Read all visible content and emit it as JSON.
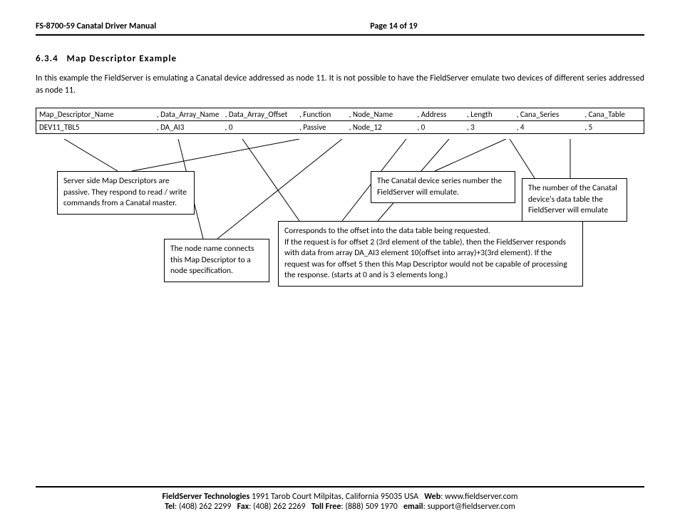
{
  "header": {
    "title": "FS-8700-59 Canatal Driver Manual",
    "page": "Page 14 of 19"
  },
  "section": {
    "number": "6.3.4",
    "title": "Map Descriptor Example",
    "intro": "In this example the FieldServer is emulating a Canatal device addressed as node 11. It is not possible to have the FieldServer emulate two devices of different series addressed as node 11."
  },
  "table": {
    "headers": [
      "Map_Descriptor_Name",
      ", Data_Array_Name",
      ", Data_Array_Offset",
      ", Function",
      ", Node_Name",
      ", Address",
      ", Length",
      ", Cana_Series",
      ", Cana_Table"
    ],
    "row": [
      "DEV11_TBL5",
      ", DA_AI3",
      ", 0",
      ", Passive",
      ", Node_12",
      ", 0",
      ", 3",
      ", 4",
      ", 5"
    ]
  },
  "callouts": {
    "server_side": "Server side Map Descriptors are passive. They respond to read / write commands from a Canatal master.",
    "node_name": "The node name connects this Map Descriptor to a node specification.",
    "series": "The Canatal device series number the FieldServer will emulate.",
    "table_num": "The number of the Canatal device's data table the FieldServer will emulate",
    "offset": "Corresponds to the offset into the data table being requested.\nIf the request is for offset 2 (3rd element of the table), then the FieldServer responds with data from array DA_AI3 element 10(offset into array)+3(3rd element). If the request was for offset 5 then this Map Descriptor would not be capable of processing the response. (starts at 0 and is 3 elements long.)"
  },
  "footer": {
    "company": "FieldServer Technologies",
    "address": "1991 Tarob Court Milpitas, California 95035 USA",
    "web_label": "Web",
    "web": "www.fieldserver.com",
    "tel_label": "Tel",
    "tel": "(408) 262 2299",
    "fax_label": "Fax",
    "fax": "(408) 262 2269",
    "toll_label": "Toll Free",
    "toll": "(888) 509 1970",
    "email_label": "email",
    "email": "support@fieldserver.com"
  }
}
